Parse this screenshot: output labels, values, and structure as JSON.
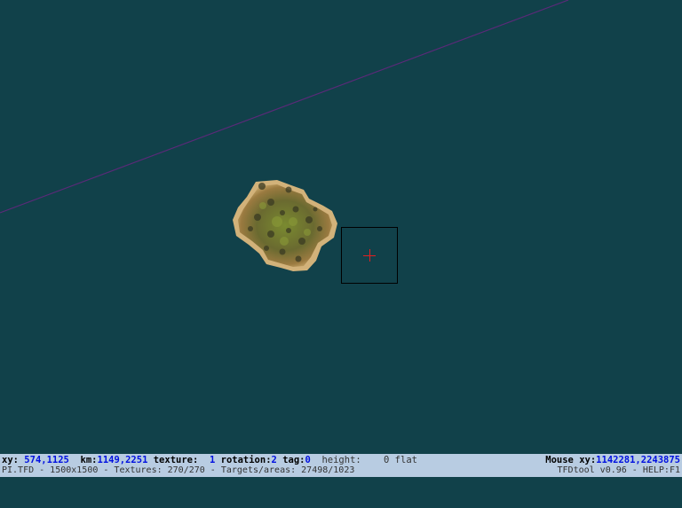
{
  "map": {
    "water_color": "#11414a",
    "flight_path_color": "#5a2a78",
    "cursor_crosshair_color": "#e02020"
  },
  "status": {
    "xy_label": "xy:",
    "xy_value": "574,1125",
    "km_label": "km:",
    "km_value": "1149,2251",
    "texture_label": "texture:",
    "texture_value": "1",
    "rotation_label": "rotation:",
    "rotation_value": "2",
    "tag_label": "tag:",
    "tag_value": "0",
    "height_label": "height:",
    "height_value": "0 flat",
    "mouse_xy_label": "Mouse xy:",
    "mouse_xy_value": "1142281,2243875",
    "file_info": "PI.TFD - 1500x1500 - Textures: 270/270 - Targets/areas: 27498/1023",
    "app_info": "TFDtool v0.96 - HELP:F1"
  }
}
